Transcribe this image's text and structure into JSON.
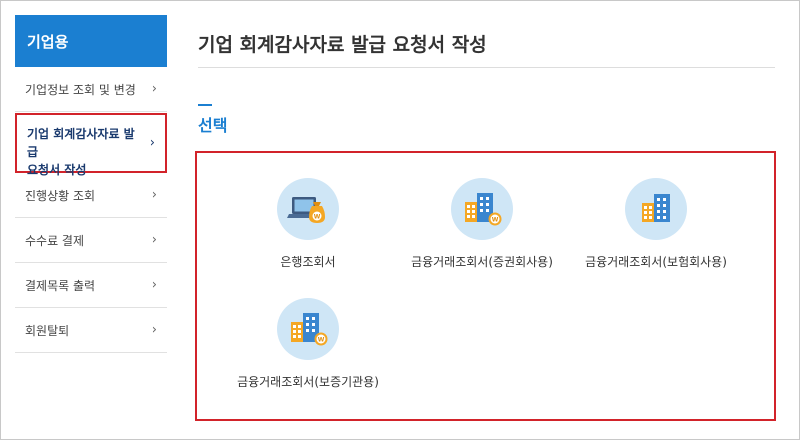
{
  "sidebar": {
    "title": "기업용",
    "items": [
      {
        "label": "기업정보 조회 및 변경"
      },
      {
        "label": "기업 회계감사자료 발급\n요청서 작성",
        "label_line1": "기업 회계감사자료 발급",
        "label_line2": "요청서 작성"
      },
      {
        "label": "진행상황 조회"
      },
      {
        "label": "수수료 결제"
      },
      {
        "label": "결제목록 출력"
      },
      {
        "label": "회원탈퇴"
      }
    ],
    "chevron": "›"
  },
  "main": {
    "title": "기업 회계감사자료 발급 요청서 작성",
    "section_title": "선택",
    "options": [
      {
        "label": "은행조회서",
        "icon": "laptop-moneybag-icon"
      },
      {
        "label": "금융거래조회서(증권회사용)",
        "icon": "building-coin-icon"
      },
      {
        "label": "금융거래조회서(보험회사용)",
        "icon": "building-icon"
      },
      {
        "label": "금융거래조회서(보증기관용)",
        "icon": "building-coin-icon"
      }
    ]
  },
  "colors": {
    "accent": "#1b7fd1",
    "highlight_border": "#d2232a",
    "icon_circle": "#cfe6f6"
  }
}
